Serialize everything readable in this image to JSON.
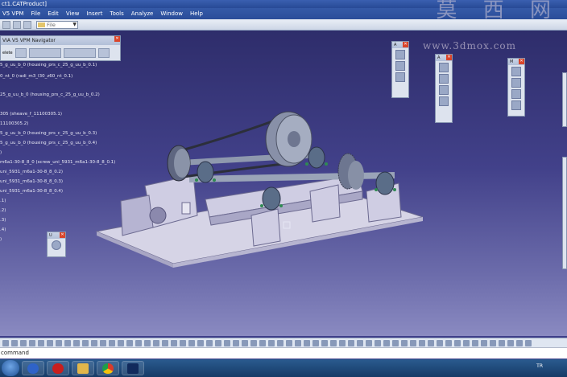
{
  "window": {
    "title": "ct1.CATProduct]"
  },
  "watermark": {
    "chars": "莫 西 网",
    "url": "www.3dmox.com"
  },
  "menu": [
    "V5 VPM",
    "File",
    "Edit",
    "View",
    "Insert",
    "Tools",
    "Analyze",
    "Window",
    "Help"
  ],
  "toolbar": {
    "file_combo": "File"
  },
  "navigator": {
    "title": "VIA V5 VPM Navigator",
    "left_label": "elete"
  },
  "tree": [
    "5_g_uu_b_0 (housing_prs_c_25_g_uu_b_0.1)",
    "0_nt_0 (radi_m3_l30_z60_nt_0.1)",
    "25_g_uu_b_0 (housing_prs_c_25_g_uu_b_0.2)",
    "305 (sheave_f_11100305.1)",
    "11100305.2)",
    "5_g_uu_b_0 (housing_prs_c_25_g_uu_b_0.3)",
    "5_g_uu_b_0 (housing_prs_c_25_g_uu_b_0.4)",
    ")",
    "m6a1-30-8_8_0 (screw_uni_5931_m6a1-30-8_8_0.1)",
    "uni_5931_m6a1-30-8_8_0.2)",
    "uni_5931_m6a1-30-8_8_0.3)",
    "uni_5931_m6a1-30-8_8_0.4)",
    ".1)",
    ".2)",
    ".3)",
    ".4)",
    ")"
  ],
  "floating_panels": [
    {
      "caption": "A"
    },
    {
      "caption": "A"
    },
    {
      "caption": "M"
    },
    {
      "caption": "U"
    }
  ],
  "command_bar": {
    "label": "command"
  },
  "tray": {
    "lang": "TR"
  },
  "colors": {
    "viewport_top": "#2e2d6b",
    "viewport_bottom": "#8a8ac1",
    "base": "#d6d4e6",
    "part_gray": "#9aa4b8",
    "bearing": "#5a6d88"
  }
}
